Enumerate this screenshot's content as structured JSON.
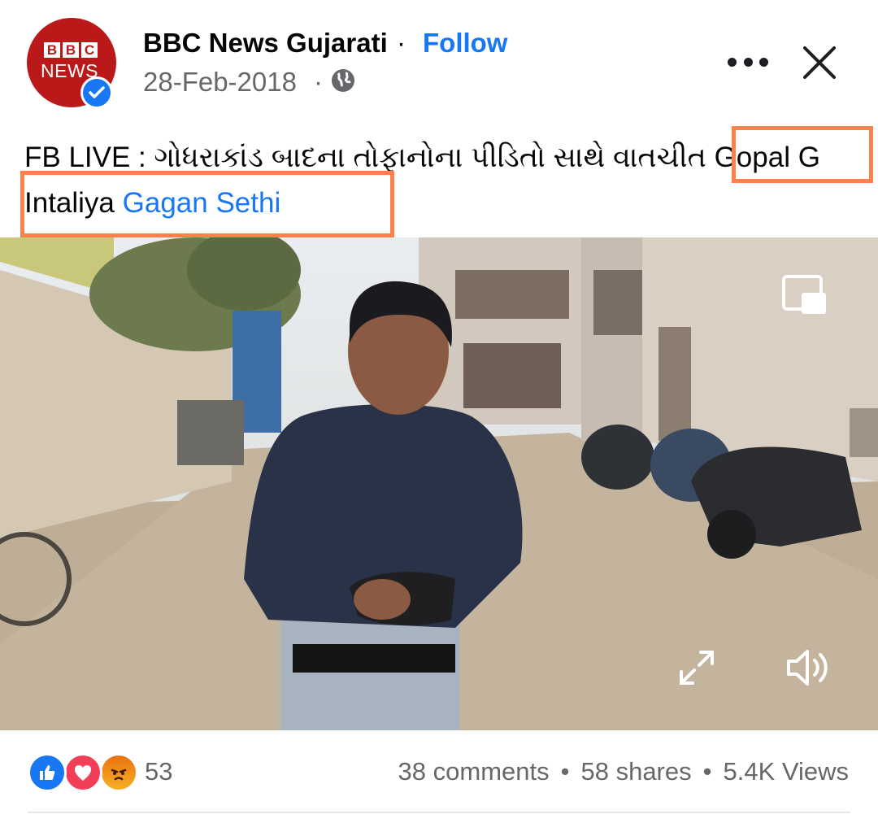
{
  "post": {
    "avatar_logo": {
      "top": "BBC",
      "bottom": "NEWS",
      "bg_color": "#bb1919"
    },
    "page_name": "BBC News Gujarati",
    "separator": "·",
    "follow_label": "Follow",
    "date": "28-Feb-2018",
    "date_separator": "·",
    "privacy_icon": "globe-icon",
    "more_icon": "more-dots-icon",
    "close_icon": "close-icon",
    "caption_prefix": "FB LIVE : ગોધરાકાંડ બાદના તોફાનોના પીડિતો સાથે વાતચીત Gopal G Intaliya",
    "caption_link": "Gagan Sethi"
  },
  "video": {
    "controls": {
      "pip_icon": "picture-in-picture-icon",
      "expand_icon": "fullscreen-icon",
      "sound_icon": "volume-icon"
    }
  },
  "footer": {
    "reactions": [
      "like",
      "love",
      "angry"
    ],
    "reaction_count": "53",
    "comments": "38 comments",
    "shares": "58 shares",
    "views": "5.4K Views",
    "dot": "•"
  },
  "colors": {
    "link": "#1877f2",
    "highlight_box": "#fb8049",
    "secondary_text": "#65676b"
  }
}
